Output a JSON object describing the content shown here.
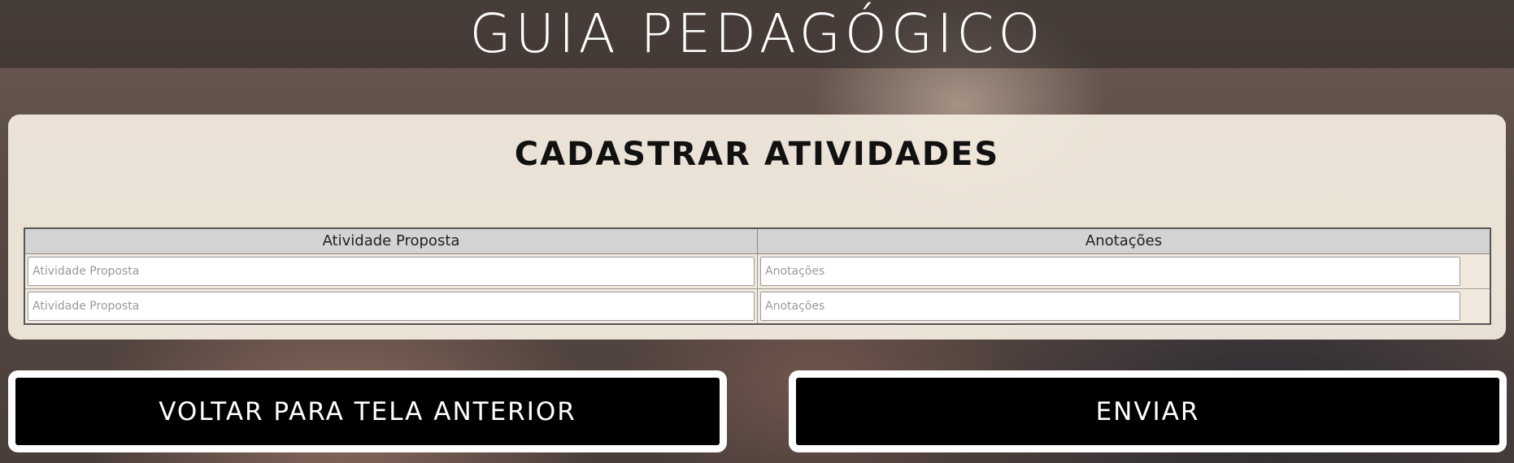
{
  "header": {
    "title": "GUIA PEDAGÓGICO"
  },
  "form": {
    "title": "CADASTRAR ATIVIDADES",
    "columns": [
      "Atividade Proposta",
      "Anotações"
    ],
    "rows": [
      {
        "activity_placeholder": "Atividade Proposta",
        "activity_value": "",
        "notes_placeholder": "Anotações",
        "notes_value": ""
      },
      {
        "activity_placeholder": "Atividade Proposta",
        "activity_value": "",
        "notes_placeholder": "Anotações",
        "notes_value": ""
      }
    ]
  },
  "actions": {
    "back_label": "VOLTAR PARA TELA ANTERIOR",
    "send_label": "ENVIAR"
  },
  "colors": {
    "header_band": "#282220",
    "card_background": "#f6eee2",
    "table_header": "#d3d3d3",
    "button_background": "#000000",
    "button_border": "#ffffff"
  }
}
